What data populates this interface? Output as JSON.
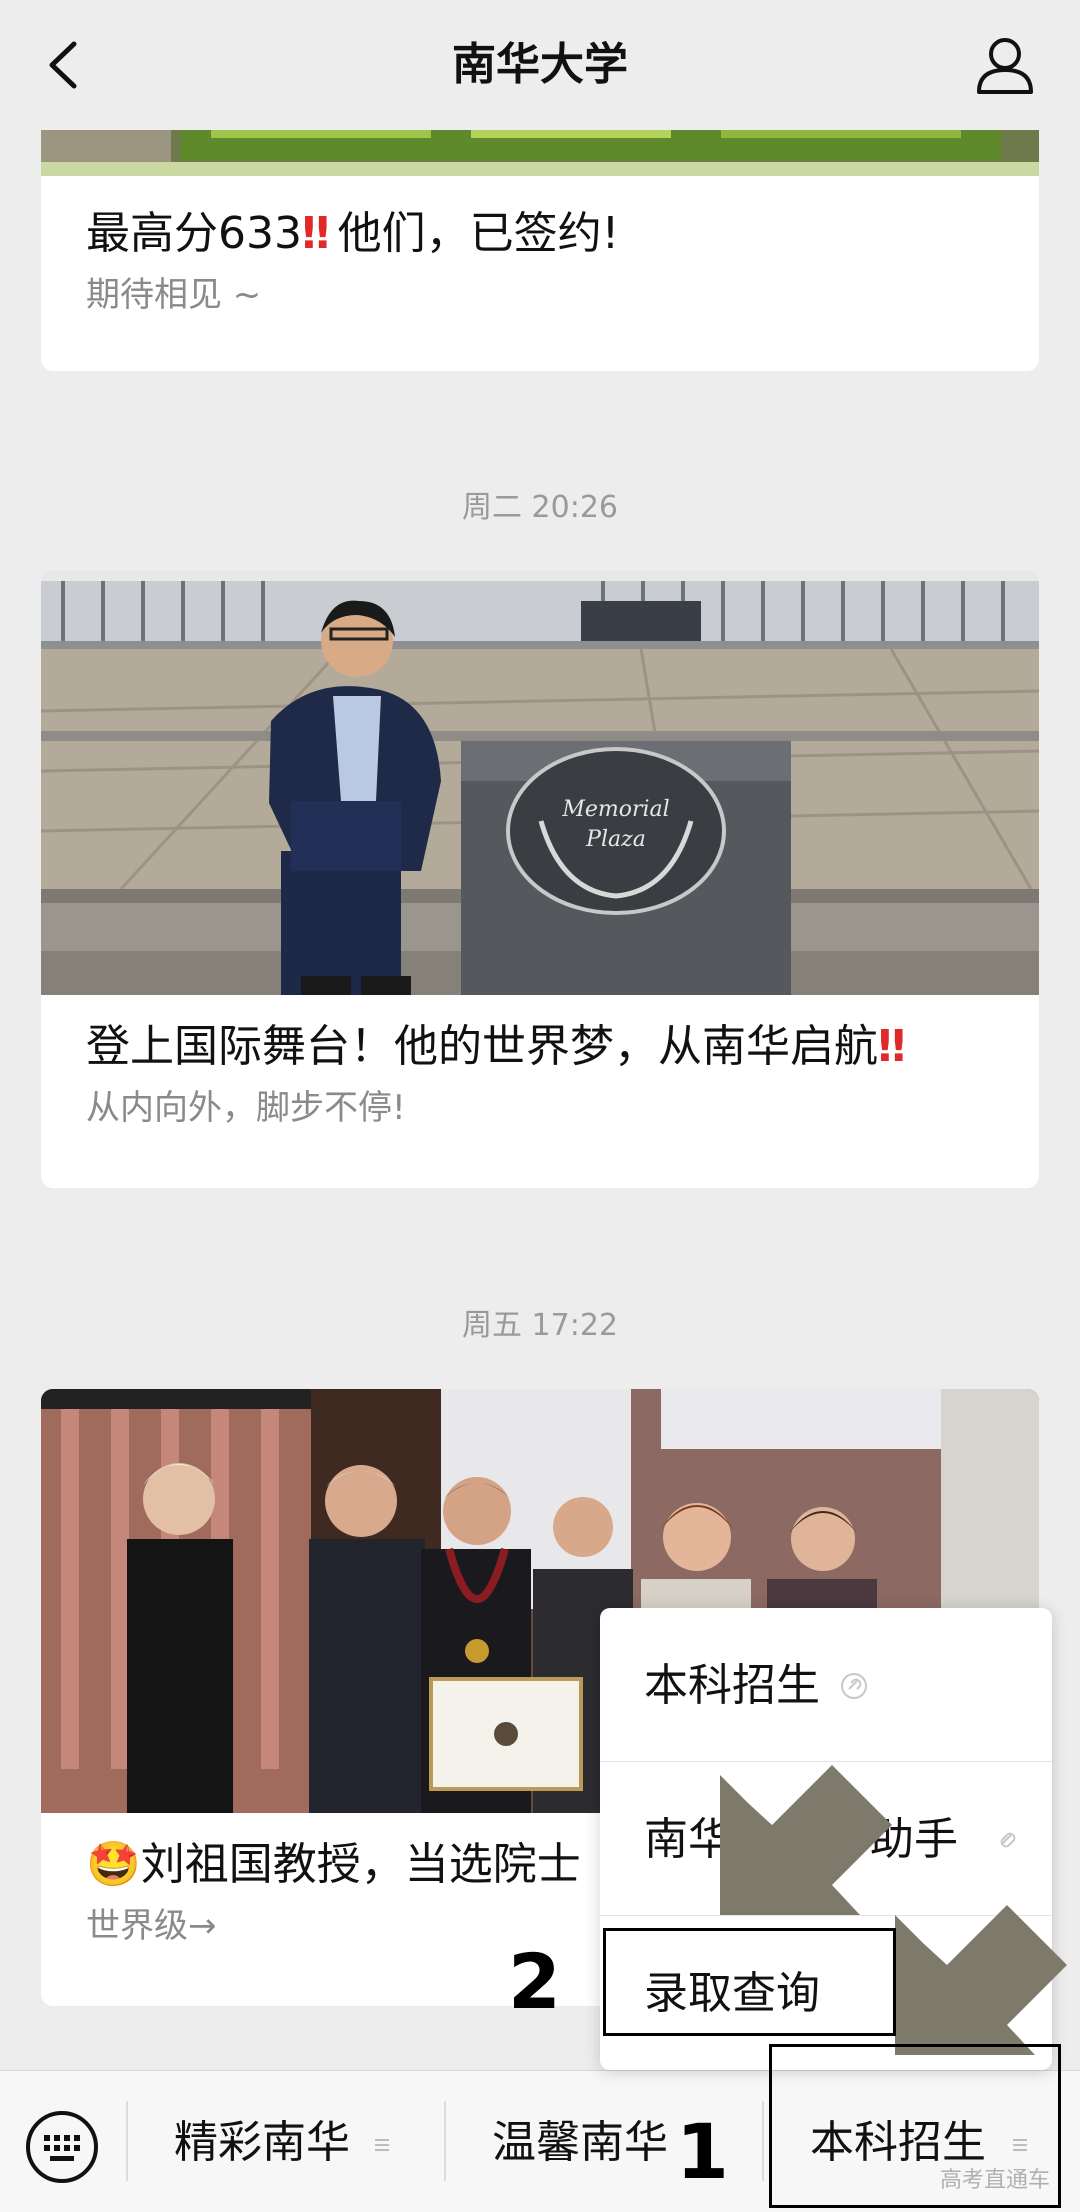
{
  "navbar": {
    "title": "南华大学"
  },
  "feed": {
    "articles": [
      {
        "title": "最高分633",
        "title_suffix": "他们，已签约!",
        "title_mark": "‼",
        "subtitle": "期待相见 ~"
      },
      {
        "title": "登上国际舞台！他的世界梦，从南华启航",
        "title_mark": "‼",
        "subtitle": "从内向外，脚步不停!",
        "cover_sign_text": [
          "Memorial",
          "Plaza"
        ]
      },
      {
        "title_emoji": "🤩",
        "title": "刘祖国教授，当选院士",
        "subtitle": "世界级→"
      }
    ],
    "timestamps": [
      "周二 20:26",
      "周五 17:22"
    ]
  },
  "popup_menu": {
    "items": [
      {
        "label": "本科招生"
      },
      {
        "label": "南华",
        "label_end": "助手"
      },
      {
        "label": "录取查询"
      }
    ]
  },
  "bottom_menu": {
    "items": [
      {
        "label": "精彩南华"
      },
      {
        "label": "温馨南华"
      },
      {
        "label": "本科招生"
      }
    ]
  },
  "annotations": {
    "step1": "1",
    "step2": "2"
  },
  "watermark": "高考直通车",
  "colors": {
    "background": "#ededed",
    "card": "#ffffff",
    "accent_red": "#e02a2a",
    "arrow": "#7d7a6c"
  }
}
